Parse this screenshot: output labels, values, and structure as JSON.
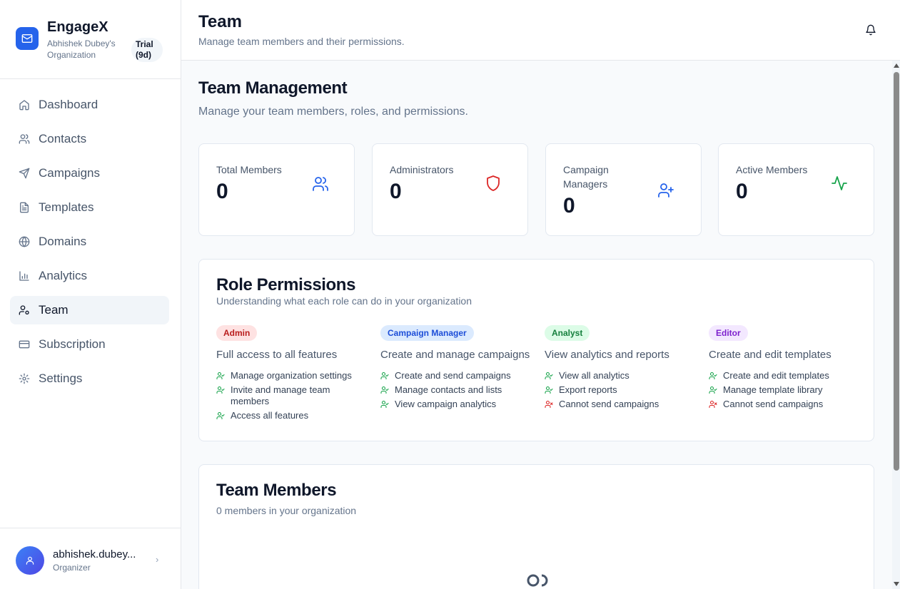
{
  "app": {
    "name": "EngageX",
    "org": "Abhishek Dubey's Organization",
    "trial": "Trial (9d)"
  },
  "sidebar": {
    "items": [
      {
        "label": "Dashboard",
        "icon": "home-icon"
      },
      {
        "label": "Contacts",
        "icon": "users-icon"
      },
      {
        "label": "Campaigns",
        "icon": "send-icon"
      },
      {
        "label": "Templates",
        "icon": "file-text-icon"
      },
      {
        "label": "Domains",
        "icon": "globe-icon"
      },
      {
        "label": "Analytics",
        "icon": "bar-chart-icon"
      },
      {
        "label": "Team",
        "icon": "user-cog-icon",
        "active": true
      },
      {
        "label": "Subscription",
        "icon": "credit-card-icon"
      },
      {
        "label": "Settings",
        "icon": "gear-icon"
      }
    ]
  },
  "user": {
    "name": "abhishek.dubey...",
    "role": "Organizer"
  },
  "header": {
    "title": "Team",
    "subtitle": "Manage team members and their permissions."
  },
  "main": {
    "title": "Team Management",
    "subtitle": "Manage your team members, roles, and permissions."
  },
  "stats": [
    {
      "label": "Total Members",
      "value": "0",
      "icon": "users-icon",
      "color": "#2563eb"
    },
    {
      "label": "Administrators",
      "value": "0",
      "icon": "shield-icon",
      "color": "#dc2626"
    },
    {
      "label": "Campaign Managers",
      "value": "0",
      "icon": "user-plus-icon",
      "color": "#2563eb"
    },
    {
      "label": "Active Members",
      "value": "0",
      "icon": "activity-icon",
      "color": "#16a34a"
    }
  ],
  "permissions": {
    "title": "Role Permissions",
    "subtitle": "Understanding what each role can do in your organization",
    "roles": [
      {
        "name": "Admin",
        "bg": "#fee2e2",
        "fg": "#b91c1c",
        "desc": "Full access to all features",
        "perms": [
          {
            "text": "Manage organization settings",
            "allowed": true
          },
          {
            "text": "Invite and manage team members",
            "allowed": true
          },
          {
            "text": "Access all features",
            "allowed": true
          }
        ]
      },
      {
        "name": "Campaign Manager",
        "bg": "#dbeafe",
        "fg": "#1d4ed8",
        "desc": "Create and manage campaigns",
        "perms": [
          {
            "text": "Create and send campaigns",
            "allowed": true
          },
          {
            "text": "Manage contacts and lists",
            "allowed": true
          },
          {
            "text": "View campaign analytics",
            "allowed": true
          }
        ]
      },
      {
        "name": "Analyst",
        "bg": "#dcfce7",
        "fg": "#15803d",
        "desc": "View analytics and reports",
        "perms": [
          {
            "text": "View all analytics",
            "allowed": true
          },
          {
            "text": "Export reports",
            "allowed": true
          },
          {
            "text": "Cannot send campaigns",
            "allowed": false
          }
        ]
      },
      {
        "name": "Editor",
        "bg": "#f3e8ff",
        "fg": "#7e22ce",
        "desc": "Create and edit templates",
        "perms": [
          {
            "text": "Create and edit templates",
            "allowed": true
          },
          {
            "text": "Manage template library",
            "allowed": true
          },
          {
            "text": "Cannot send campaigns",
            "allowed": false
          }
        ]
      }
    ]
  },
  "members": {
    "title": "Team Members",
    "subtitle": "0 members in your organization"
  }
}
